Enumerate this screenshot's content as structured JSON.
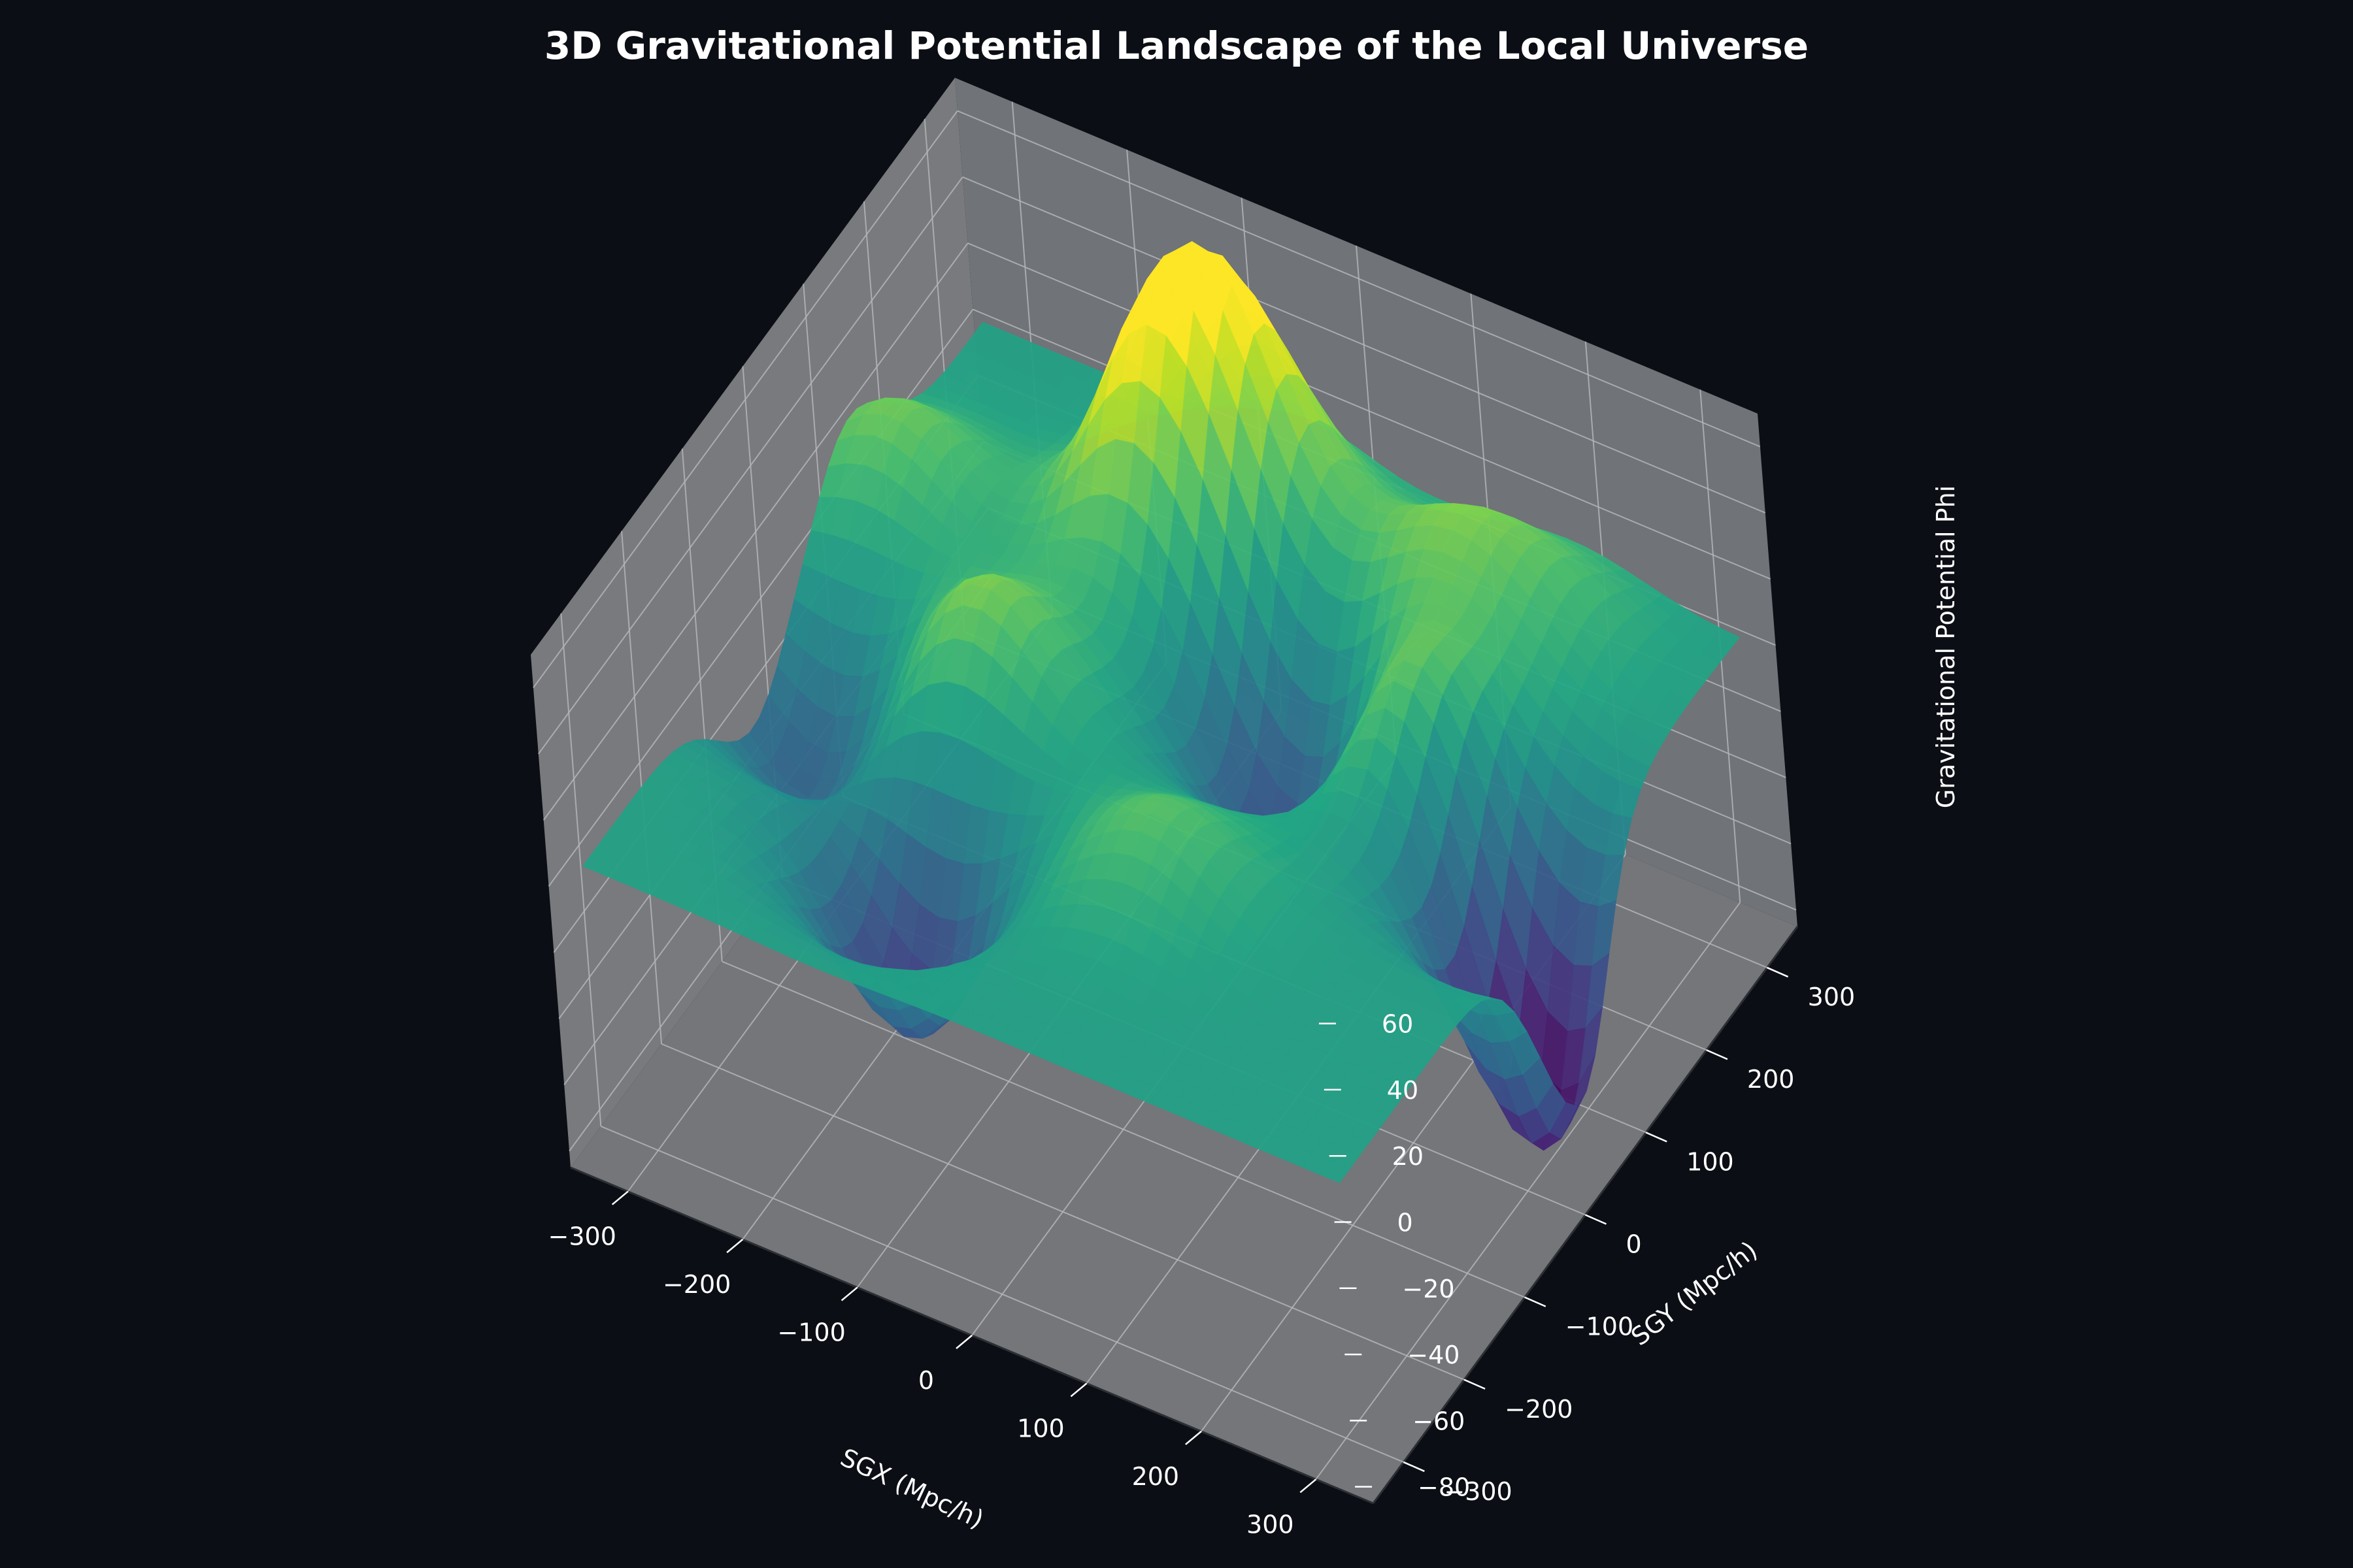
{
  "chart_data": {
    "type": "surface",
    "title": "3D Gravitational Potential Landscape of the Local Universe",
    "xlabel": "SGX (Mpc/h)",
    "ylabel": "SGY (Mpc/h)",
    "zlabel": "Gravitational Potential Phi",
    "xlim": [
      -350,
      350
    ],
    "ylim": [
      -350,
      350
    ],
    "zlim": [
      -85,
      70
    ],
    "x_ticks": [
      "−300",
      "−200",
      "−100",
      "0",
      "100",
      "200",
      "300"
    ],
    "y_ticks": [
      "−300",
      "−200",
      "−100",
      "0",
      "100",
      "200",
      "300"
    ],
    "z_ticks": [
      "−80",
      "−60",
      "−40",
      "−20",
      "0",
      "20",
      "40",
      "60"
    ],
    "colormap": "viridis",
    "grid": true,
    "features": [
      {
        "kind": "peak",
        "x": -40,
        "y": 230,
        "phi": 65
      },
      {
        "kind": "peak",
        "x": -90,
        "y": 175,
        "phi": 60
      },
      {
        "kind": "peak",
        "x": -290,
        "y": 120,
        "phi": 35
      },
      {
        "kind": "peak",
        "x": -140,
        "y": -20,
        "phi": 40
      },
      {
        "kind": "peak",
        "x": 120,
        "y": 220,
        "phi": 30
      },
      {
        "kind": "peak",
        "x": 180,
        "y": 90,
        "phi": 40
      },
      {
        "kind": "peak",
        "x": 200,
        "y": 250,
        "phi": 25
      },
      {
        "kind": "peak",
        "x": 70,
        "y": -130,
        "phi": 28
      },
      {
        "kind": "trough",
        "x": 290,
        "y": 40,
        "phi": -85
      },
      {
        "kind": "trough",
        "x": -130,
        "y": -180,
        "phi": -55
      },
      {
        "kind": "trough",
        "x": 50,
        "y": 90,
        "phi": -45
      },
      {
        "kind": "trough",
        "x": -280,
        "y": -60,
        "phi": -35
      }
    ],
    "background_phi": 4
  },
  "colors": {
    "background": "#0b0e14",
    "pane": "#7a7c80",
    "grid": "#b3b5b8",
    "text": "#ffffff"
  }
}
